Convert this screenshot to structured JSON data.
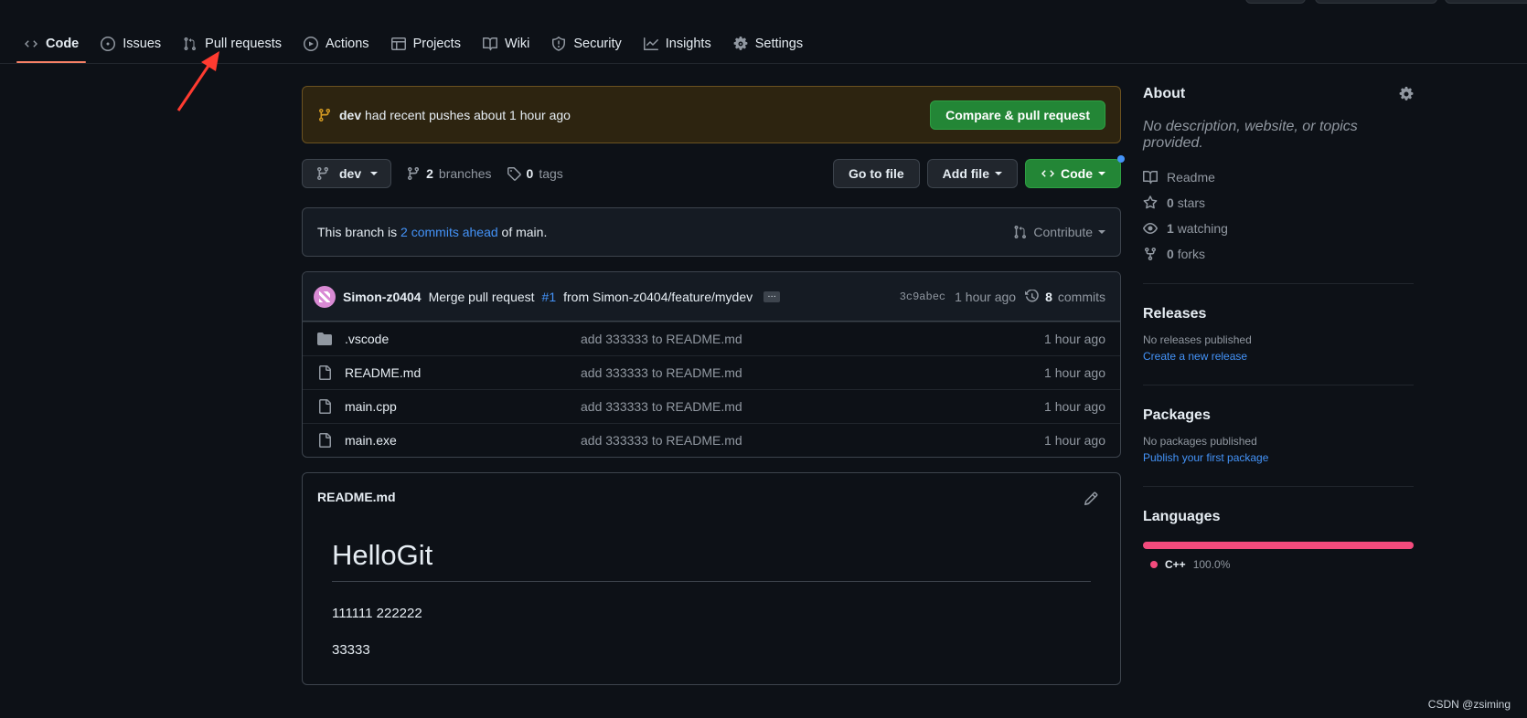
{
  "nav": {
    "tabs": [
      {
        "label": "Code",
        "icon": "code-icon"
      },
      {
        "label": "Issues",
        "icon": "issue-icon"
      },
      {
        "label": "Pull requests",
        "icon": "pull-request-icon"
      },
      {
        "label": "Actions",
        "icon": "play-icon"
      },
      {
        "label": "Projects",
        "icon": "table-icon"
      },
      {
        "label": "Wiki",
        "icon": "book-icon"
      },
      {
        "label": "Security",
        "icon": "shield-icon"
      },
      {
        "label": "Insights",
        "icon": "graph-icon"
      },
      {
        "label": "Settings",
        "icon": "gear-icon"
      }
    ],
    "active": "Code"
  },
  "banner": {
    "branch": "dev",
    "text": "had recent pushes about 1 hour ago",
    "button": "Compare & pull request"
  },
  "branch_bar": {
    "current_branch": "dev",
    "branches_count": "2",
    "branches_label": "branches",
    "tags_count": "0",
    "tags_label": "tags",
    "go_to_file": "Go to file",
    "add_file": "Add file",
    "code": "Code"
  },
  "ahead": {
    "prefix": "This branch is",
    "link": "2 commits ahead",
    "suffix": "of main.",
    "contribute": "Contribute"
  },
  "latest_commit": {
    "author": "Simon-z0404",
    "message_pre": "Merge pull request",
    "pr_link": "#1",
    "message_post": "from Simon-z0404/feature/mydev",
    "ellipsis": "…",
    "sha": "3c9abec",
    "time": "1 hour ago",
    "commits_count": "8",
    "commits_label": "commits"
  },
  "files": [
    {
      "name": ".vscode",
      "type": "folder",
      "message": "add 333333 to README.md",
      "time": "1 hour ago"
    },
    {
      "name": "README.md",
      "type": "file",
      "message": "add 333333 to README.md",
      "time": "1 hour ago"
    },
    {
      "name": "main.cpp",
      "type": "file",
      "message": "add 333333 to README.md",
      "time": "1 hour ago"
    },
    {
      "name": "main.exe",
      "type": "file",
      "message": "add 333333 to README.md",
      "time": "1 hour ago"
    }
  ],
  "readme": {
    "filename": "README.md",
    "heading": "HelloGit",
    "line1": "111111 222222",
    "line2": "33333"
  },
  "about": {
    "title": "About",
    "description": "No description, website, or topics provided.",
    "readme": "Readme",
    "stars_count": "0",
    "stars_label": "stars",
    "watching_count": "1",
    "watching_label": "watching",
    "forks_count": "0",
    "forks_label": "forks"
  },
  "releases": {
    "title": "Releases",
    "empty": "No releases published",
    "link": "Create a new release"
  },
  "packages": {
    "title": "Packages",
    "empty": "No packages published",
    "link": "Publish your first package"
  },
  "languages": {
    "title": "Languages",
    "items": [
      {
        "name": "C++",
        "percent": "100.0%",
        "color": "#f34b7d",
        "fraction": 1.0
      }
    ]
  },
  "colors": {
    "accent_tab": "#f78166",
    "green_button": "#238636",
    "link": "#4493f8",
    "annotation": "#ff3b30"
  },
  "watermark": "CSDN @zsiming"
}
